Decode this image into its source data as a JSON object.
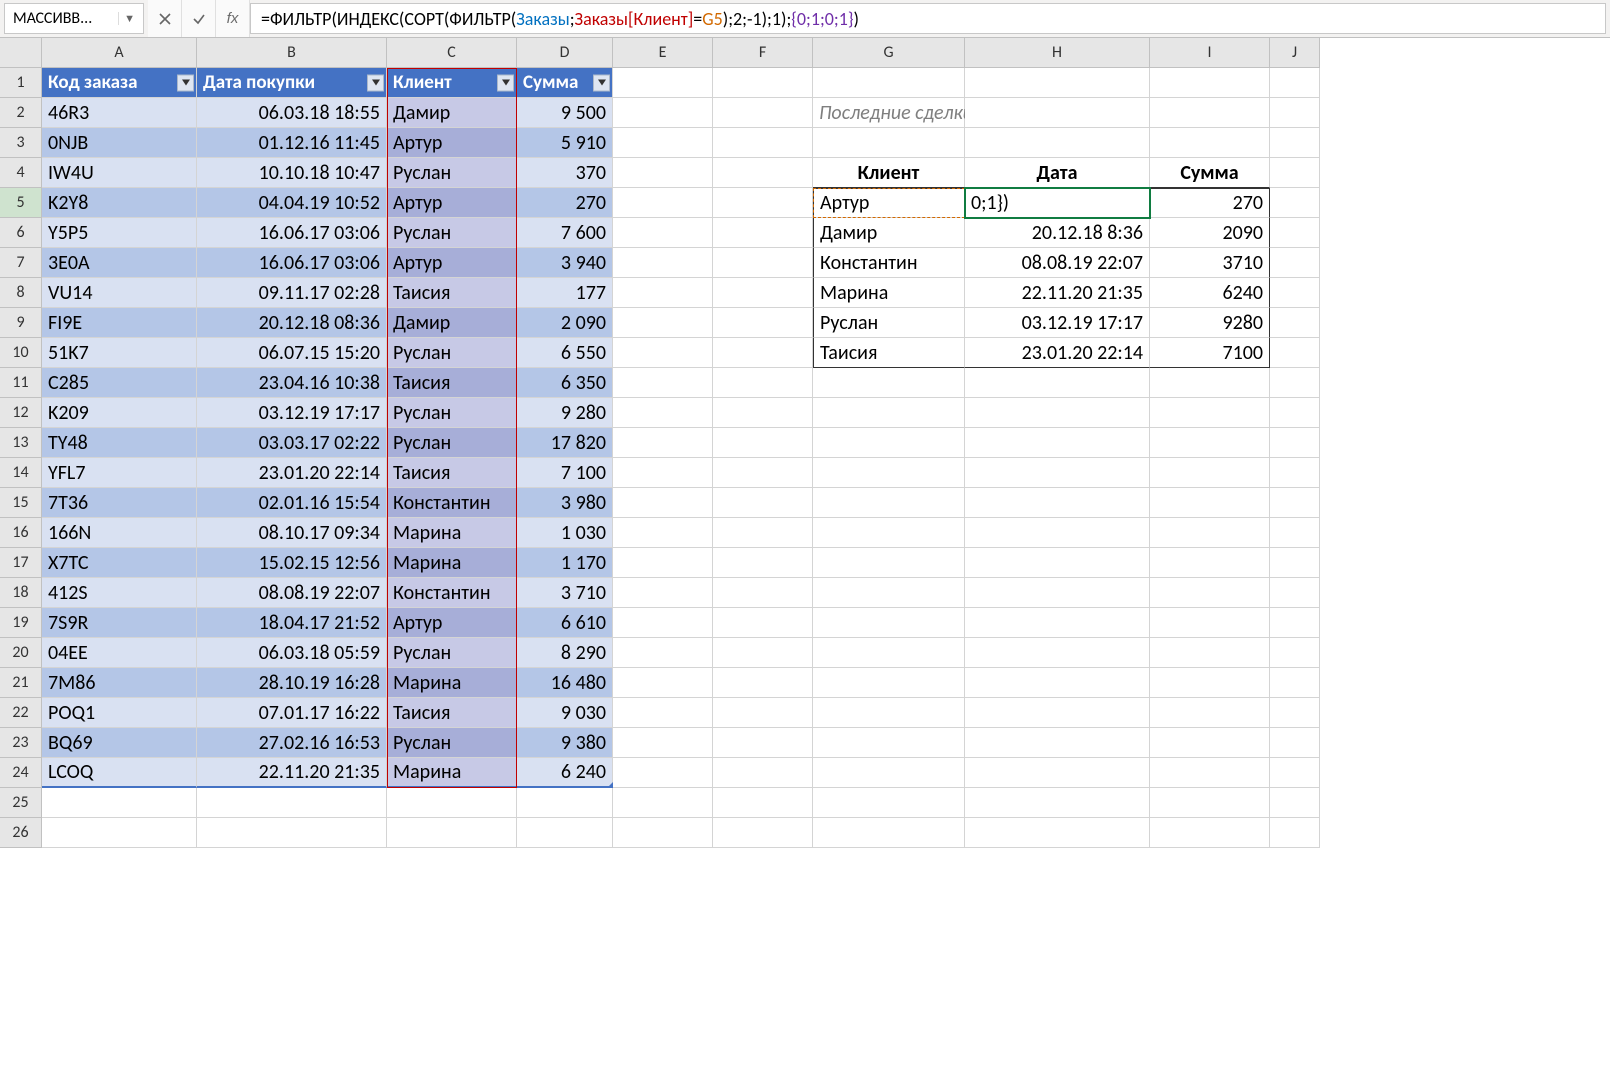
{
  "name_box": "МАССИВВ...",
  "formula_parts": [
    {
      "t": "=ФИЛЬТР(ИНДЕКС(СОРТ(ФИЛЬТР(",
      "c": ""
    },
    {
      "t": "Заказы",
      "c": "t-blue"
    },
    {
      "t": ";",
      "c": ""
    },
    {
      "t": "Заказы[Клиент]",
      "c": "t-red"
    },
    {
      "t": "=",
      "c": ""
    },
    {
      "t": "G5",
      "c": "t-orange"
    },
    {
      "t": ");2;-1);1);",
      "c": ""
    },
    {
      "t": "{0;1;0;1}",
      "c": "t-purple"
    },
    {
      "t": ")",
      "c": ""
    }
  ],
  "columns": [
    "A",
    "B",
    "C",
    "D",
    "E",
    "F",
    "G",
    "H",
    "I",
    "J"
  ],
  "row_count": 26,
  "table": {
    "headers": [
      "Код заказа",
      "Дата покупки",
      "Клиент",
      "Сумма"
    ],
    "rows": [
      {
        "code": "46R3",
        "date": "06.03.18 18:55",
        "client": "Дамир",
        "sum": "9 500"
      },
      {
        "code": "0NJB",
        "date": "01.12.16 11:45",
        "client": "Артур",
        "sum": "5 910"
      },
      {
        "code": "IW4U",
        "date": "10.10.18 10:47",
        "client": "Руслан",
        "sum": "370"
      },
      {
        "code": "K2Y8",
        "date": "04.04.19 10:52",
        "client": "Артур",
        "sum": "270"
      },
      {
        "code": "Y5P5",
        "date": "16.06.17 03:06",
        "client": "Руслан",
        "sum": "7 600"
      },
      {
        "code": "3E0A",
        "date": "16.06.17 03:06",
        "client": "Артур",
        "sum": "3 940"
      },
      {
        "code": "VU14",
        "date": "09.11.17 02:28",
        "client": "Таисия",
        "sum": "177"
      },
      {
        "code": "FI9E",
        "date": "20.12.18 08:36",
        "client": "Дамир",
        "sum": "2 090"
      },
      {
        "code": "51K7",
        "date": "06.07.15 15:20",
        "client": "Руслан",
        "sum": "6 550"
      },
      {
        "code": "C285",
        "date": "23.04.16 10:38",
        "client": "Таисия",
        "sum": "6 350"
      },
      {
        "code": "K209",
        "date": "03.12.19 17:17",
        "client": "Руслан",
        "sum": "9 280"
      },
      {
        "code": "TY48",
        "date": "03.03.17 02:22",
        "client": "Руслан",
        "sum": "17 820"
      },
      {
        "code": "YFL7",
        "date": "23.01.20 22:14",
        "client": "Таисия",
        "sum": "7 100"
      },
      {
        "code": "7T36",
        "date": "02.01.16 15:54",
        "client": "Константин",
        "sum": "3 980"
      },
      {
        "code": "166N",
        "date": "08.10.17 09:34",
        "client": "Марина",
        "sum": "1 030"
      },
      {
        "code": "X7TC",
        "date": "15.02.15 12:56",
        "client": "Марина",
        "sum": "1 170"
      },
      {
        "code": "412S",
        "date": "08.08.19 22:07",
        "client": "Константин",
        "sum": "3 710"
      },
      {
        "code": "7S9R",
        "date": "18.04.17 21:52",
        "client": "Артур",
        "sum": "6 610"
      },
      {
        "code": "04EE",
        "date": "06.03.18 05:59",
        "client": "Руслан",
        "sum": "8 290"
      },
      {
        "code": "7M86",
        "date": "28.10.19 16:28",
        "client": "Марина",
        "sum": "16 480"
      },
      {
        "code": "POQ1",
        "date": "07.01.17 16:22",
        "client": "Таисия",
        "sum": "9 030"
      },
      {
        "code": "BQ69",
        "date": "27.02.16 16:53",
        "client": "Руслан",
        "sum": "9 380"
      },
      {
        "code": "LCOQ",
        "date": "22.11.20 21:35",
        "client": "Марина",
        "sum": "6 240"
      }
    ]
  },
  "summary": {
    "title": "Последние сделки по каждому клиенту",
    "headers": [
      "Клиент",
      "Дата",
      "Сумма"
    ],
    "editing_cell_display": "0;1})",
    "rows": [
      {
        "client": "Артур",
        "date": "",
        "sum": "270"
      },
      {
        "client": "Дамир",
        "date": "20.12.18 8:36",
        "sum": "2090"
      },
      {
        "client": "Константин",
        "date": "08.08.19 22:07",
        "sum": "3710"
      },
      {
        "client": "Марина",
        "date": "22.11.20 21:35",
        "sum": "6240"
      },
      {
        "client": "Руслан",
        "date": "03.12.19 17:17",
        "sum": "9280"
      },
      {
        "client": "Таисия",
        "date": "23.01.20 22:14",
        "sum": "7100"
      }
    ]
  }
}
